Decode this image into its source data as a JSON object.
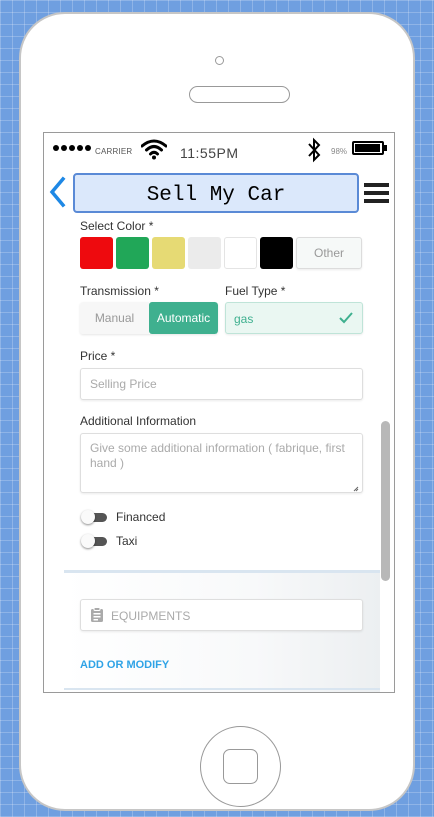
{
  "status_bar": {
    "carrier": "CARRIER",
    "time": "11:55PM",
    "battery_percent": "98%"
  },
  "header": {
    "title": "Sell My Car",
    "back_icon": "chevron-left-icon",
    "menu_icon": "hamburger-menu-icon"
  },
  "form": {
    "color": {
      "label": "Select Color *",
      "swatches": [
        "#ee0a0e",
        "#21a758",
        "#e6da74",
        "#ebebeb",
        "#ffffff",
        "#000000"
      ],
      "other_label": "Other"
    },
    "transmission": {
      "label": "Transmission *",
      "options": [
        "Manual",
        "Automatic"
      ],
      "selected": "Automatic",
      "accent": "#3fb08f"
    },
    "fuel": {
      "label": "Fuel Type *",
      "value": "gas"
    },
    "price": {
      "label": "Price *",
      "placeholder": "Selling Price"
    },
    "additional": {
      "label": "Additional Information",
      "placeholder": "Give some additional information ( fabrique, first hand )"
    },
    "toggles": [
      {
        "label": "Financed",
        "on": false
      },
      {
        "label": "Taxi",
        "on": false
      }
    ]
  },
  "equipments": {
    "label": "EQUIPMENTS",
    "link": "ADD OR MODIFY"
  }
}
